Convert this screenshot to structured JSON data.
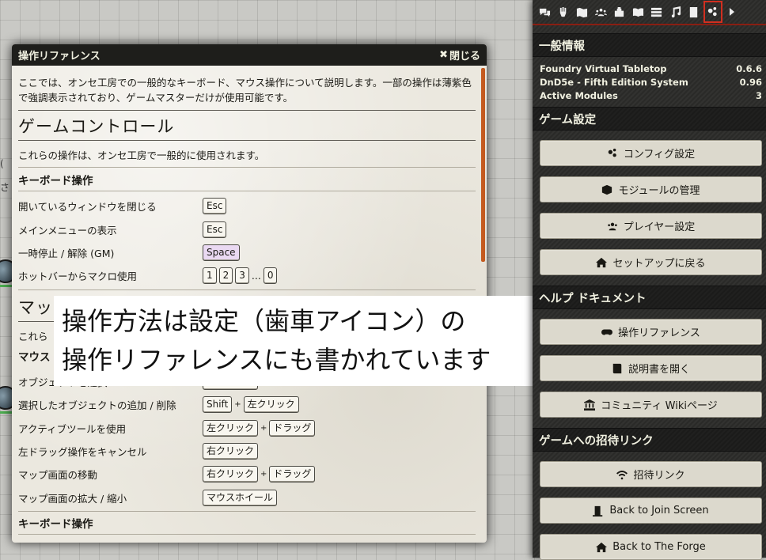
{
  "window": {
    "title": "操作リファレンス",
    "close_label": "閉じる",
    "intro": "ここでは、オンセ工房での一般的なキーボード、マウス操作について説明します。一部の操作は薄紫色で強調表示されており、ゲームマスターだけが使用可能です。",
    "sections": [
      {
        "title": "ゲームコントロール",
        "desc": "これらの操作は、オンセ工房で一般的に使用されます。",
        "subtitle": "キーボード操作",
        "rows": [
          {
            "label": "開いているウィンドウを閉じる",
            "keys": [
              "Esc"
            ]
          },
          {
            "label": "メインメニューの表示",
            "keys": [
              "Esc"
            ]
          },
          {
            "label": "一時停止 / 解除 (GM)",
            "keys": [
              "Space"
            ]
          },
          {
            "label": "ホットバーからマクロ使用",
            "keys": [
              "1",
              "2",
              "3",
              "...",
              "0"
            ]
          }
        ]
      },
      {
        "title_fragment": "マッ",
        "desc_fragment": "これら",
        "subtitle_fragment": "マウス",
        "rows": [
          {
            "label": "オブジェクトを選択",
            "keys": [
              "左クリック"
            ]
          },
          {
            "label": "選択したオブジェクトの追加 / 削除",
            "keys": [
              "Shift",
              "+",
              "左クリック"
            ]
          },
          {
            "label": "アクティブツールを使用",
            "keys": [
              "左クリック",
              "+",
              "ドラッグ"
            ]
          },
          {
            "label": "左ドラッグ操作をキャンセル",
            "keys": [
              "右クリック"
            ]
          },
          {
            "label": "マップ画面の移動",
            "keys": [
              "右クリック",
              "+",
              "ドラッグ"
            ]
          },
          {
            "label": "マップ画面の拡大 / 縮小",
            "keys": [
              "マウスホイール"
            ]
          }
        ]
      }
    ],
    "next_heading_fragment": "キーボード操作"
  },
  "caption": {
    "line1": "操作方法は設定（歯車アイコン）の",
    "line2": "操作リファレンスにも書かれています"
  },
  "canvas_scraps": [
    "(",
    "さ"
  ],
  "sidebar": {
    "tabs": [
      "chat-icon",
      "combat-icon",
      "scenes-icon",
      "actors-icon",
      "items-icon",
      "journal-icon",
      "tables-icon",
      "playlists-icon",
      "compendium-icon",
      "settings-icon",
      "collapse-arrow-icon"
    ],
    "general": {
      "heading": "一般情報",
      "info": [
        {
          "label": "Foundry Virtual Tabletop",
          "value": "0.6.6"
        },
        {
          "label": "DnD5e - Fifth Edition System",
          "value": "0.96"
        },
        {
          "label": "Active Modules",
          "value": "3"
        }
      ]
    },
    "game_settings": {
      "heading": "ゲーム設定",
      "buttons": [
        {
          "label": "コンフィグ設定",
          "icon": "cogs-icon"
        },
        {
          "label": "モジュールの管理",
          "icon": "cube-icon"
        },
        {
          "label": "プレイヤー設定",
          "icon": "users-icon"
        },
        {
          "label": "セットアップに戻る",
          "icon": "home-icon"
        }
      ]
    },
    "help": {
      "heading": "ヘルプ ドキュメント",
      "buttons": [
        {
          "label": "操作リファレンス",
          "icon": "gamepad-icon"
        },
        {
          "label": "説明書を開く",
          "icon": "book-icon"
        },
        {
          "label": "コミュニティ Wikiページ",
          "icon": "university-icon"
        }
      ]
    },
    "invite": {
      "heading": "ゲームへの招待リンク",
      "buttons": [
        {
          "label": "招待リンク",
          "icon": "wifi-icon"
        },
        {
          "label": "Back to Join Screen",
          "icon": "door-icon"
        },
        {
          "label": "Back to The Forge",
          "icon": "home-icon"
        }
      ]
    }
  },
  "colors": {
    "accent": "#d12f20",
    "gm_key": "#ead9f2",
    "scrollbar": "#c45a1f",
    "header": "#1e1e1b"
  }
}
